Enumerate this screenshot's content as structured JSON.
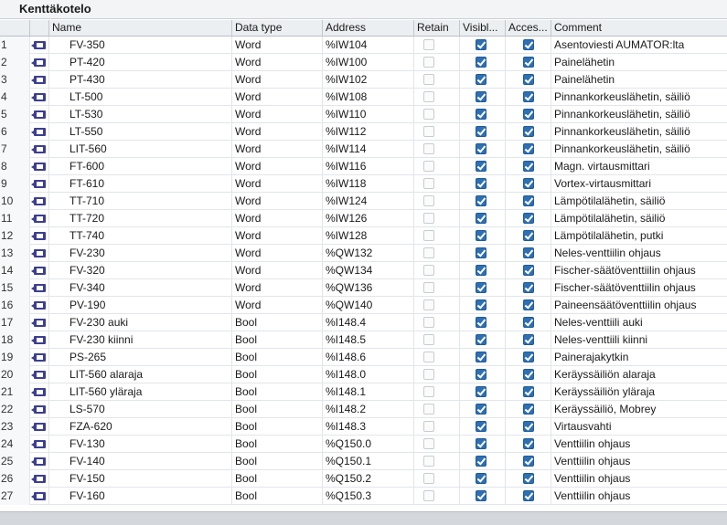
{
  "title": "Kenttäkotelo",
  "columns": {
    "name": "Name",
    "data_type": "Data type",
    "address": "Address",
    "retain": "Retain",
    "visible": "Visibl...",
    "accessible": "Acces...",
    "comment": "Comment"
  },
  "rows": [
    {
      "num": "1",
      "name": "FV-350",
      "type": "Word",
      "address": "%IW104",
      "retain": false,
      "visible": true,
      "accessible": true,
      "comment": "Asentoviesti AUMATOR:lta"
    },
    {
      "num": "2",
      "name": "PT-420",
      "type": "Word",
      "address": "%IW100",
      "retain": false,
      "visible": true,
      "accessible": true,
      "comment": "Painelähetin"
    },
    {
      "num": "3",
      "name": "PT-430",
      "type": "Word",
      "address": "%IW102",
      "retain": false,
      "visible": true,
      "accessible": true,
      "comment": "Painelähetin"
    },
    {
      "num": "4",
      "name": "LT-500",
      "type": "Word",
      "address": "%IW108",
      "retain": false,
      "visible": true,
      "accessible": true,
      "comment": "Pinnankorkeuslähetin, säiliö"
    },
    {
      "num": "5",
      "name": "LT-530",
      "type": "Word",
      "address": "%IW110",
      "retain": false,
      "visible": true,
      "accessible": true,
      "comment": "Pinnankorkeuslähetin, säiliö"
    },
    {
      "num": "6",
      "name": "LT-550",
      "type": "Word",
      "address": "%IW112",
      "retain": false,
      "visible": true,
      "accessible": true,
      "comment": "Pinnankorkeuslähetin, säiliö"
    },
    {
      "num": "7",
      "name": "LIT-560",
      "type": "Word",
      "address": "%IW114",
      "retain": false,
      "visible": true,
      "accessible": true,
      "comment": "Pinnankorkeuslähetin, säiliö"
    },
    {
      "num": "8",
      "name": "FT-600",
      "type": "Word",
      "address": "%IW116",
      "retain": false,
      "visible": true,
      "accessible": true,
      "comment": "Magn. virtausmittari"
    },
    {
      "num": "9",
      "name": "FT-610",
      "type": "Word",
      "address": "%IW118",
      "retain": false,
      "visible": true,
      "accessible": true,
      "comment": "Vortex-virtausmittari"
    },
    {
      "num": "10",
      "name": "TT-710",
      "type": "Word",
      "address": "%IW124",
      "retain": false,
      "visible": true,
      "accessible": true,
      "comment": "Lämpötilalähetin, säiliö"
    },
    {
      "num": "11",
      "name": "TT-720",
      "type": "Word",
      "address": "%IW126",
      "retain": false,
      "visible": true,
      "accessible": true,
      "comment": "Lämpötilalähetin, säiliö"
    },
    {
      "num": "12",
      "name": "TT-740",
      "type": "Word",
      "address": "%IW128",
      "retain": false,
      "visible": true,
      "accessible": true,
      "comment": "Lämpötilalähetin, putki"
    },
    {
      "num": "13",
      "name": "FV-230",
      "type": "Word",
      "address": "%QW132",
      "retain": false,
      "visible": true,
      "accessible": true,
      "comment": "Neles-venttiilin ohjaus"
    },
    {
      "num": "14",
      "name": "FV-320",
      "type": "Word",
      "address": "%QW134",
      "retain": false,
      "visible": true,
      "accessible": true,
      "comment": "Fischer-säätöventtiilin ohjaus"
    },
    {
      "num": "15",
      "name": "FV-340",
      "type": "Word",
      "address": "%QW136",
      "retain": false,
      "visible": true,
      "accessible": true,
      "comment": "Fischer-säätöventtiilin ohjaus"
    },
    {
      "num": "16",
      "name": "PV-190",
      "type": "Word",
      "address": "%QW140",
      "retain": false,
      "visible": true,
      "accessible": true,
      "comment": "Paineensäätöventtiilin ohjaus"
    },
    {
      "num": "17",
      "name": "FV-230 auki",
      "type": "Bool",
      "address": "%I148.4",
      "retain": false,
      "visible": true,
      "accessible": true,
      "comment": "Neles-venttiili auki"
    },
    {
      "num": "18",
      "name": "FV-230 kiinni",
      "type": "Bool",
      "address": "%I148.5",
      "retain": false,
      "visible": true,
      "accessible": true,
      "comment": "Neles-venttiili kiinni"
    },
    {
      "num": "19",
      "name": "PS-265",
      "type": "Bool",
      "address": "%I148.6",
      "retain": false,
      "visible": true,
      "accessible": true,
      "comment": "Painerajakytkin"
    },
    {
      "num": "20",
      "name": "LIT-560 alaraja",
      "type": "Bool",
      "address": "%I148.0",
      "retain": false,
      "visible": true,
      "accessible": true,
      "comment": "Keräyssäiliön alaraja"
    },
    {
      "num": "21",
      "name": "LIT-560 yläraja",
      "type": "Bool",
      "address": "%I148.1",
      "retain": false,
      "visible": true,
      "accessible": true,
      "comment": "Keräyssäiliön yläraja"
    },
    {
      "num": "22",
      "name": "LS-570",
      "type": "Bool",
      "address": "%I148.2",
      "retain": false,
      "visible": true,
      "accessible": true,
      "comment": "Keräyssäiliö, Mobrey"
    },
    {
      "num": "23",
      "name": "FZA-620",
      "type": "Bool",
      "address": "%I148.3",
      "retain": false,
      "visible": true,
      "accessible": true,
      "comment": "Virtausvahti"
    },
    {
      "num": "24",
      "name": "FV-130",
      "type": "Bool",
      "address": "%Q150.0",
      "retain": false,
      "visible": true,
      "accessible": true,
      "comment": "Venttiilin ohjaus"
    },
    {
      "num": "25",
      "name": "FV-140",
      "type": "Bool",
      "address": "%Q150.1",
      "retain": false,
      "visible": true,
      "accessible": true,
      "comment": "Venttiilin ohjaus"
    },
    {
      "num": "26",
      "name": "FV-150",
      "type": "Bool",
      "address": "%Q150.2",
      "retain": false,
      "visible": true,
      "accessible": true,
      "comment": "Venttiilin ohjaus"
    },
    {
      "num": "27",
      "name": "FV-160",
      "type": "Bool",
      "address": "%Q150.3",
      "retain": false,
      "visible": true,
      "accessible": true,
      "comment": "Venttiilin ohjaus"
    }
  ]
}
